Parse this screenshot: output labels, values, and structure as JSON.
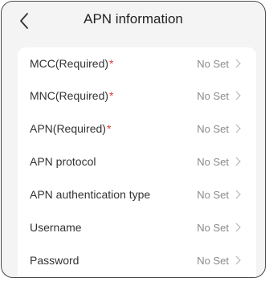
{
  "header": {
    "title": "APN information",
    "back_icon": "chevron-left-icon"
  },
  "required_marker": "*",
  "colors": {
    "required": "#e53935",
    "value_text": "#8a8a8a",
    "background": "#f4f4f4"
  },
  "rows": [
    {
      "label": "MCC(Required)",
      "required": true,
      "value": "No Set"
    },
    {
      "label": "MNC(Required)",
      "required": true,
      "value": "No Set"
    },
    {
      "label": "APN(Required)",
      "required": true,
      "value": "No Set"
    },
    {
      "label": "APN protocol",
      "required": false,
      "value": "No Set"
    },
    {
      "label": "APN authentication type",
      "required": false,
      "value": "No Set"
    },
    {
      "label": "Username",
      "required": false,
      "value": "No Set"
    },
    {
      "label": "Password",
      "required": false,
      "value": "No Set"
    }
  ]
}
